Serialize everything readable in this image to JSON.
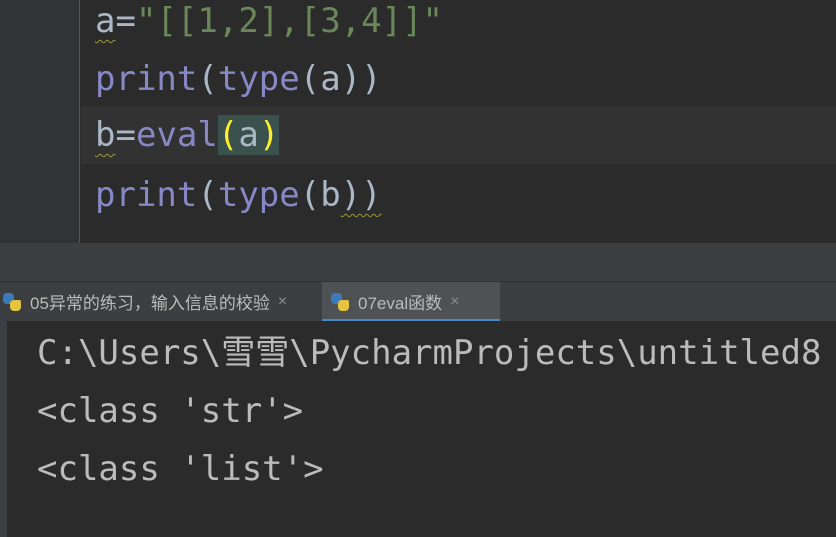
{
  "editor": {
    "lines": [
      {
        "var": "a",
        "op": "=",
        "str": "\"[[1,2],[3,4]]\""
      },
      {
        "fn": "print",
        "open1": "(",
        "fn2": "type",
        "open2": "(",
        "arg": "a",
        "close": "))"
      },
      {
        "var": "b",
        "op": "=",
        "fn": "eval",
        "open": "(",
        "arg": "a",
        "close": ")"
      },
      {
        "fn": "print",
        "open1": "(",
        "fn2": "type",
        "open2": "(",
        "arg": "b",
        "close": "))"
      }
    ]
  },
  "run_tabs": [
    {
      "label": "05异常的练习，输入信息的校验",
      "close": "×",
      "active": false
    },
    {
      "label": "07eval函数",
      "close": "×",
      "active": true
    }
  ],
  "console": {
    "lines": [
      "C:\\Users\\雪雪\\PycharmProjects\\untitled8",
      "<class 'str'>",
      "<class 'list'>"
    ]
  },
  "colors": {
    "editor_bg": "#2b2b2b",
    "keyword_fn": "#8888c6",
    "string": "#6a8759",
    "text": "#a9b7c6",
    "brace_highlight": "#ffef28",
    "tab_accent": "#4a88c7"
  }
}
